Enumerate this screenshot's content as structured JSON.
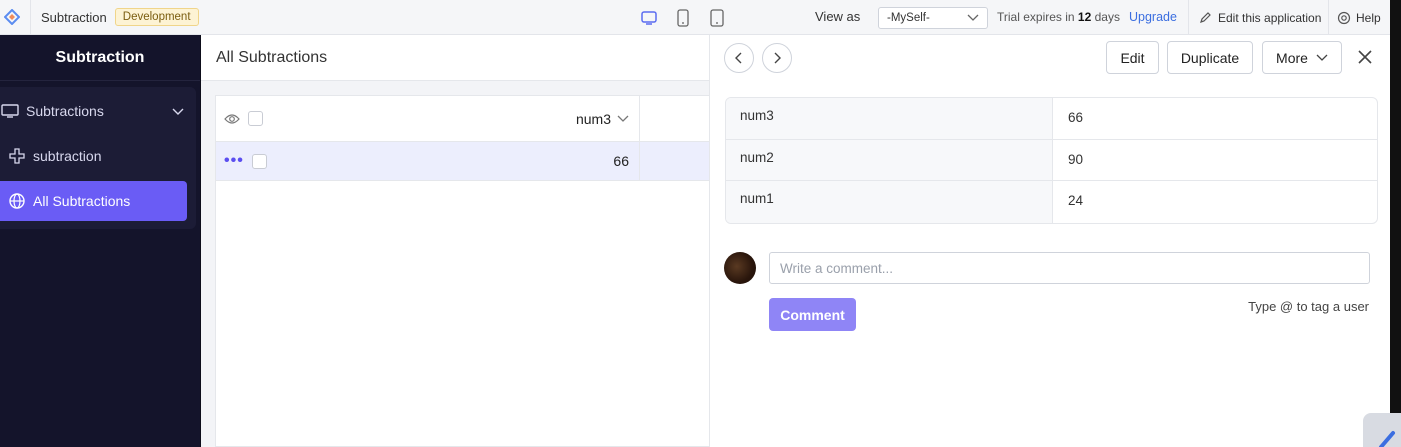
{
  "topbar": {
    "app_name": "Subtraction",
    "env_badge": "Development",
    "view_as_label": "View as",
    "view_as_value": "-MySelf-",
    "trial_prefix": "Trial expires in",
    "trial_days": "12",
    "trial_suffix": "days",
    "upgrade": "Upgrade",
    "edit_app": "Edit this application",
    "help": "Help"
  },
  "sidebar": {
    "title": "Subtraction",
    "group_label": "Subtractions",
    "items": [
      {
        "label": "subtraction",
        "icon": "plus-icon"
      },
      {
        "label": "All Subtractions",
        "icon": "globe-icon",
        "active": true
      }
    ]
  },
  "main": {
    "title": "All Subtractions",
    "columns": [
      "num3"
    ],
    "rows": [
      {
        "num3": "66"
      }
    ]
  },
  "detail": {
    "buttons": {
      "edit": "Edit",
      "duplicate": "Duplicate",
      "more": "More"
    },
    "fields": [
      {
        "name": "num3",
        "value": "66"
      },
      {
        "name": "num2",
        "value": "90"
      },
      {
        "name": "num1",
        "value": "24"
      }
    ],
    "comment_placeholder": "Write a comment...",
    "comment_button": "Comment",
    "tag_hint": "Type @ to tag a user"
  },
  "colors": {
    "accent": "#6a5cf5",
    "sidebar_bg": "#14142b",
    "upgrade_link": "#3b6ee0",
    "badge_bg": "#fdf3d4"
  }
}
